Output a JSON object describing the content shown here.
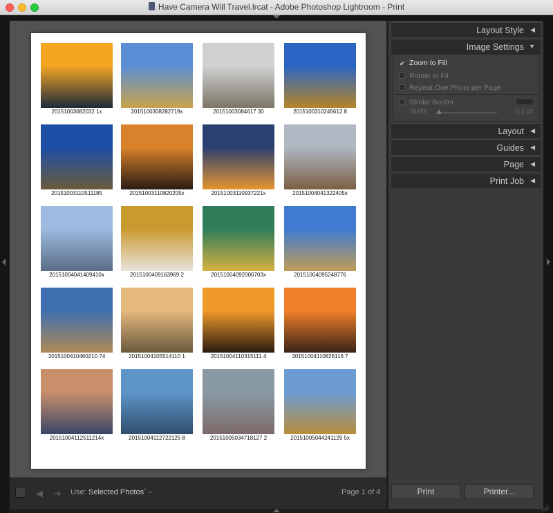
{
  "window": {
    "title": "Have Camera Will Travel.lrcat - Adobe Photoshop Lightroom - Print"
  },
  "photos": [
    {
      "caption": "20151003082032 1x",
      "top": "#f4a623",
      "bottom": "#1e2a3a"
    },
    {
      "caption": "2015100308282719x",
      "top": "#5a8fd6",
      "bottom": "#c9a24a"
    },
    {
      "caption": "20151003084617 30",
      "top": "#cfd1d3",
      "bottom": "#7d7666"
    },
    {
      "caption": "2015100310245612 8",
      "top": "#2c66c4",
      "bottom": "#b58427"
    },
    {
      "caption": "20151003110511185",
      "top": "#1d4fa6",
      "bottom": "#6a5a3c"
    },
    {
      "caption": "20151003110820205x",
      "top": "#d9822b",
      "bottom": "#2a1c13"
    },
    {
      "caption": "20151003110937221x",
      "top": "#2b3f70",
      "bottom": "#e59430"
    },
    {
      "caption": "20151004041322405x",
      "top": "#aeb7c2",
      "bottom": "#7c6045"
    },
    {
      "caption": "20151004041409410x",
      "top": "#9dbbe0",
      "bottom": "#5a6d85"
    },
    {
      "caption": "2015100409163969 2",
      "top": "#c99a2e",
      "bottom": "#e8e3dd"
    },
    {
      "caption": "20151004092000703x",
      "top": "#2f7d5a",
      "bottom": "#d6b042"
    },
    {
      "caption": "20151004095248776",
      "top": "#3f7bd0",
      "bottom": "#c29c58"
    },
    {
      "caption": "2015100410460210 74",
      "top": "#3f6fb0",
      "bottom": "#b08a55"
    },
    {
      "caption": "20151004105514110 1",
      "top": "#e6b97c",
      "bottom": "#6b5a3e"
    },
    {
      "caption": "20151004110315111 4",
      "top": "#f09a2a",
      "bottom": "#2a1a10"
    },
    {
      "caption": "20151004110826116 7",
      "top": "#f0802a",
      "bottom": "#3a2416"
    },
    {
      "caption": "20151004112511214x",
      "top": "#c98f6b",
      "bottom": "#3a4566"
    },
    {
      "caption": "20151004112722125 8",
      "top": "#5e95c9",
      "bottom": "#2f4e6e"
    },
    {
      "caption": "20151005034718127 2",
      "top": "#8a9aa5",
      "bottom": "#7c6a6a"
    },
    {
      "caption": "20151005044241129 5x",
      "top": "#6b9ad2",
      "bottom": "#b88e3c"
    }
  ],
  "toolbar": {
    "use_label": "Use:",
    "use_value": "Selected Photos",
    "page_indicator": "Page 1 of 4"
  },
  "panel": {
    "sections": [
      {
        "label": "Layout Style",
        "arrow": "◀"
      },
      {
        "label": "Image Settings",
        "arrow": "▼"
      },
      {
        "label": "Layout",
        "arrow": "◀"
      },
      {
        "label": "Guides",
        "arrow": "◀"
      },
      {
        "label": "Page",
        "arrow": "◀"
      },
      {
        "label": "Print Job",
        "arrow": "◀"
      }
    ],
    "image_settings": {
      "zoom_to_fill": "Zoom to Fill",
      "zoom_to_fill_checked": true,
      "rotate_to_fit": "Rotate to Fit",
      "repeat_one_photo": "Repeat One Photo per Page",
      "stroke_border": "Stroke Border",
      "width_label": "Width",
      "width_value": "0.1 pt"
    },
    "print_button": "Print",
    "printer_button": "Printer..."
  }
}
